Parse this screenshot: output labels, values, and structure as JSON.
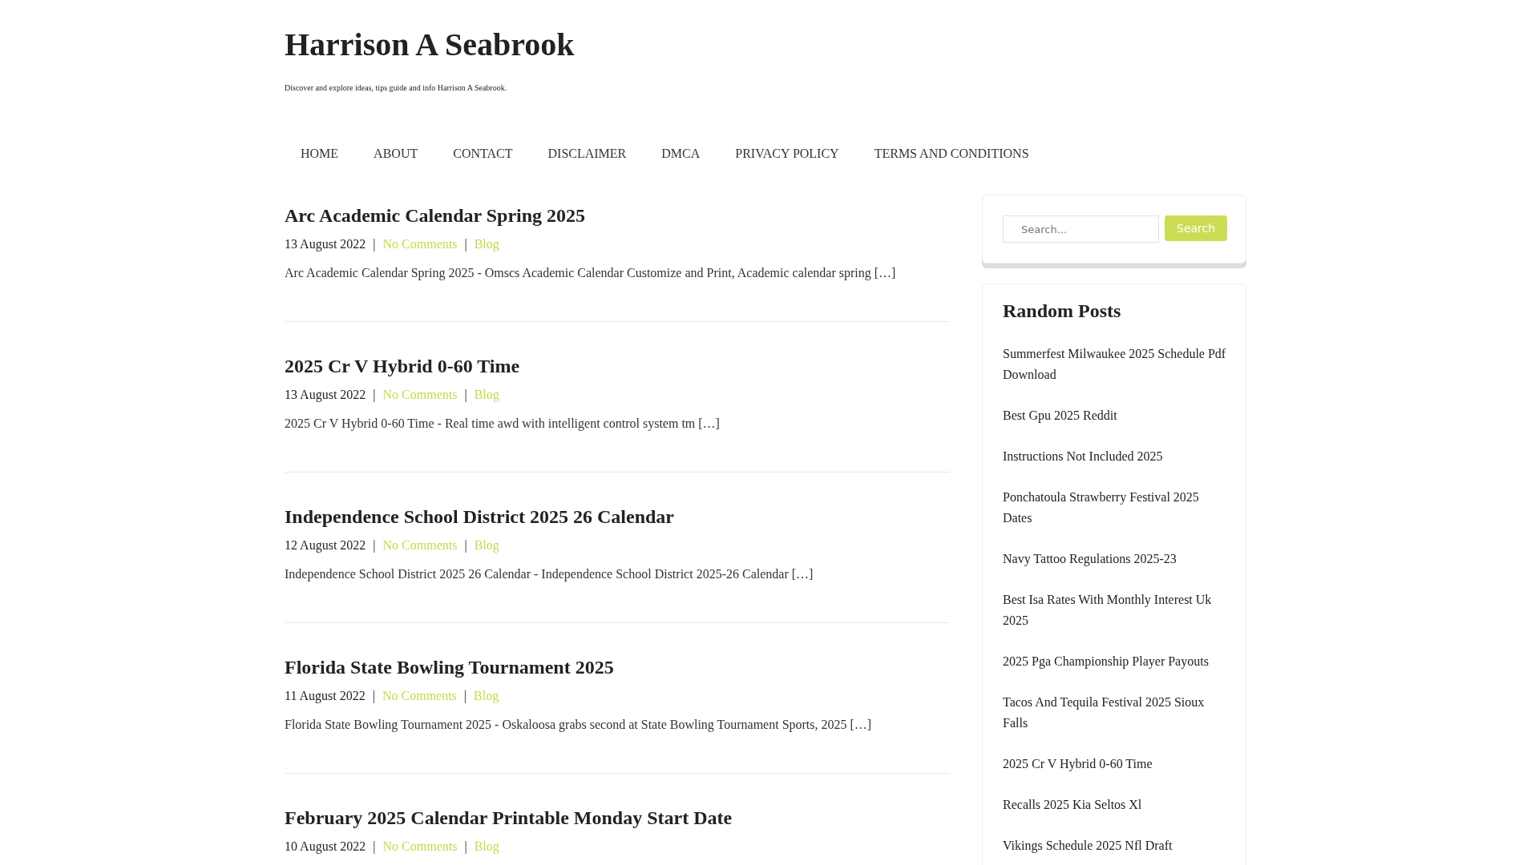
{
  "site": {
    "title": "Harrison A Seabrook",
    "tagline": "Discover and explore ideas, tips guide and info Harrison A Seabrook."
  },
  "nav": [
    "HOME",
    "ABOUT",
    "CONTACT",
    "DISCLAIMER",
    "DMCA",
    "PRIVACY POLICY",
    "TERMS AND CONDITIONS"
  ],
  "meta_separator": "|",
  "posts": [
    {
      "title": "Arc Academic Calendar Spring 2025",
      "date": "13 August 2022",
      "comments": "No Comments",
      "category": "Blog",
      "excerpt": "Arc Academic Calendar Spring 2025 - Omscs Academic Calendar Customize and Print, Academic calendar spring […]"
    },
    {
      "title": "2025 Cr V Hybrid 0-60 Time",
      "date": "13 August 2022",
      "comments": "No Comments",
      "category": "Blog",
      "excerpt": "2025 Cr V Hybrid 0-60 Time - Real time awd with intelligent control system tm […]"
    },
    {
      "title": "Independence School District 2025 26 Calendar",
      "date": "12 August 2022",
      "comments": "No Comments",
      "category": "Blog",
      "excerpt": "Independence School District 2025 26 Calendar - Independence School District 2025-26 Calendar […]"
    },
    {
      "title": "Florida State Bowling Tournament 2025",
      "date": "11 August 2022",
      "comments": "No Comments",
      "category": "Blog",
      "excerpt": "Florida State Bowling Tournament 2025 - Oskaloosa grabs second at State Bowling Tournament Sports, 2025 […]"
    },
    {
      "title": "February 2025 Calendar Printable Monday Start Date",
      "date": "10 August 2022",
      "comments": "No Comments",
      "category": "Blog"
    }
  ],
  "search": {
    "placeholder": "Search...",
    "button": "Search"
  },
  "random_posts": {
    "title": "Random Posts",
    "items": [
      "Summerfest Milwaukee 2025 Schedule Pdf Download",
      "Best Gpu 2025 Reddit",
      "Instructions Not Included 2025",
      "Ponchatoula Strawberry Festival 2025 Dates",
      "Navy Tattoo Regulations 2025-23",
      "Best Isa Rates With Monthly Interest Uk 2025",
      "2025 Pga Championship Player Payouts",
      "Tacos And Tequila Festival 2025 Sioux Falls",
      "2025 Cr V Hybrid 0-60 Time",
      "Recalls 2025 Kia Seltos Xl",
      "Vikings Schedule 2025 Nfl Draft"
    ]
  }
}
